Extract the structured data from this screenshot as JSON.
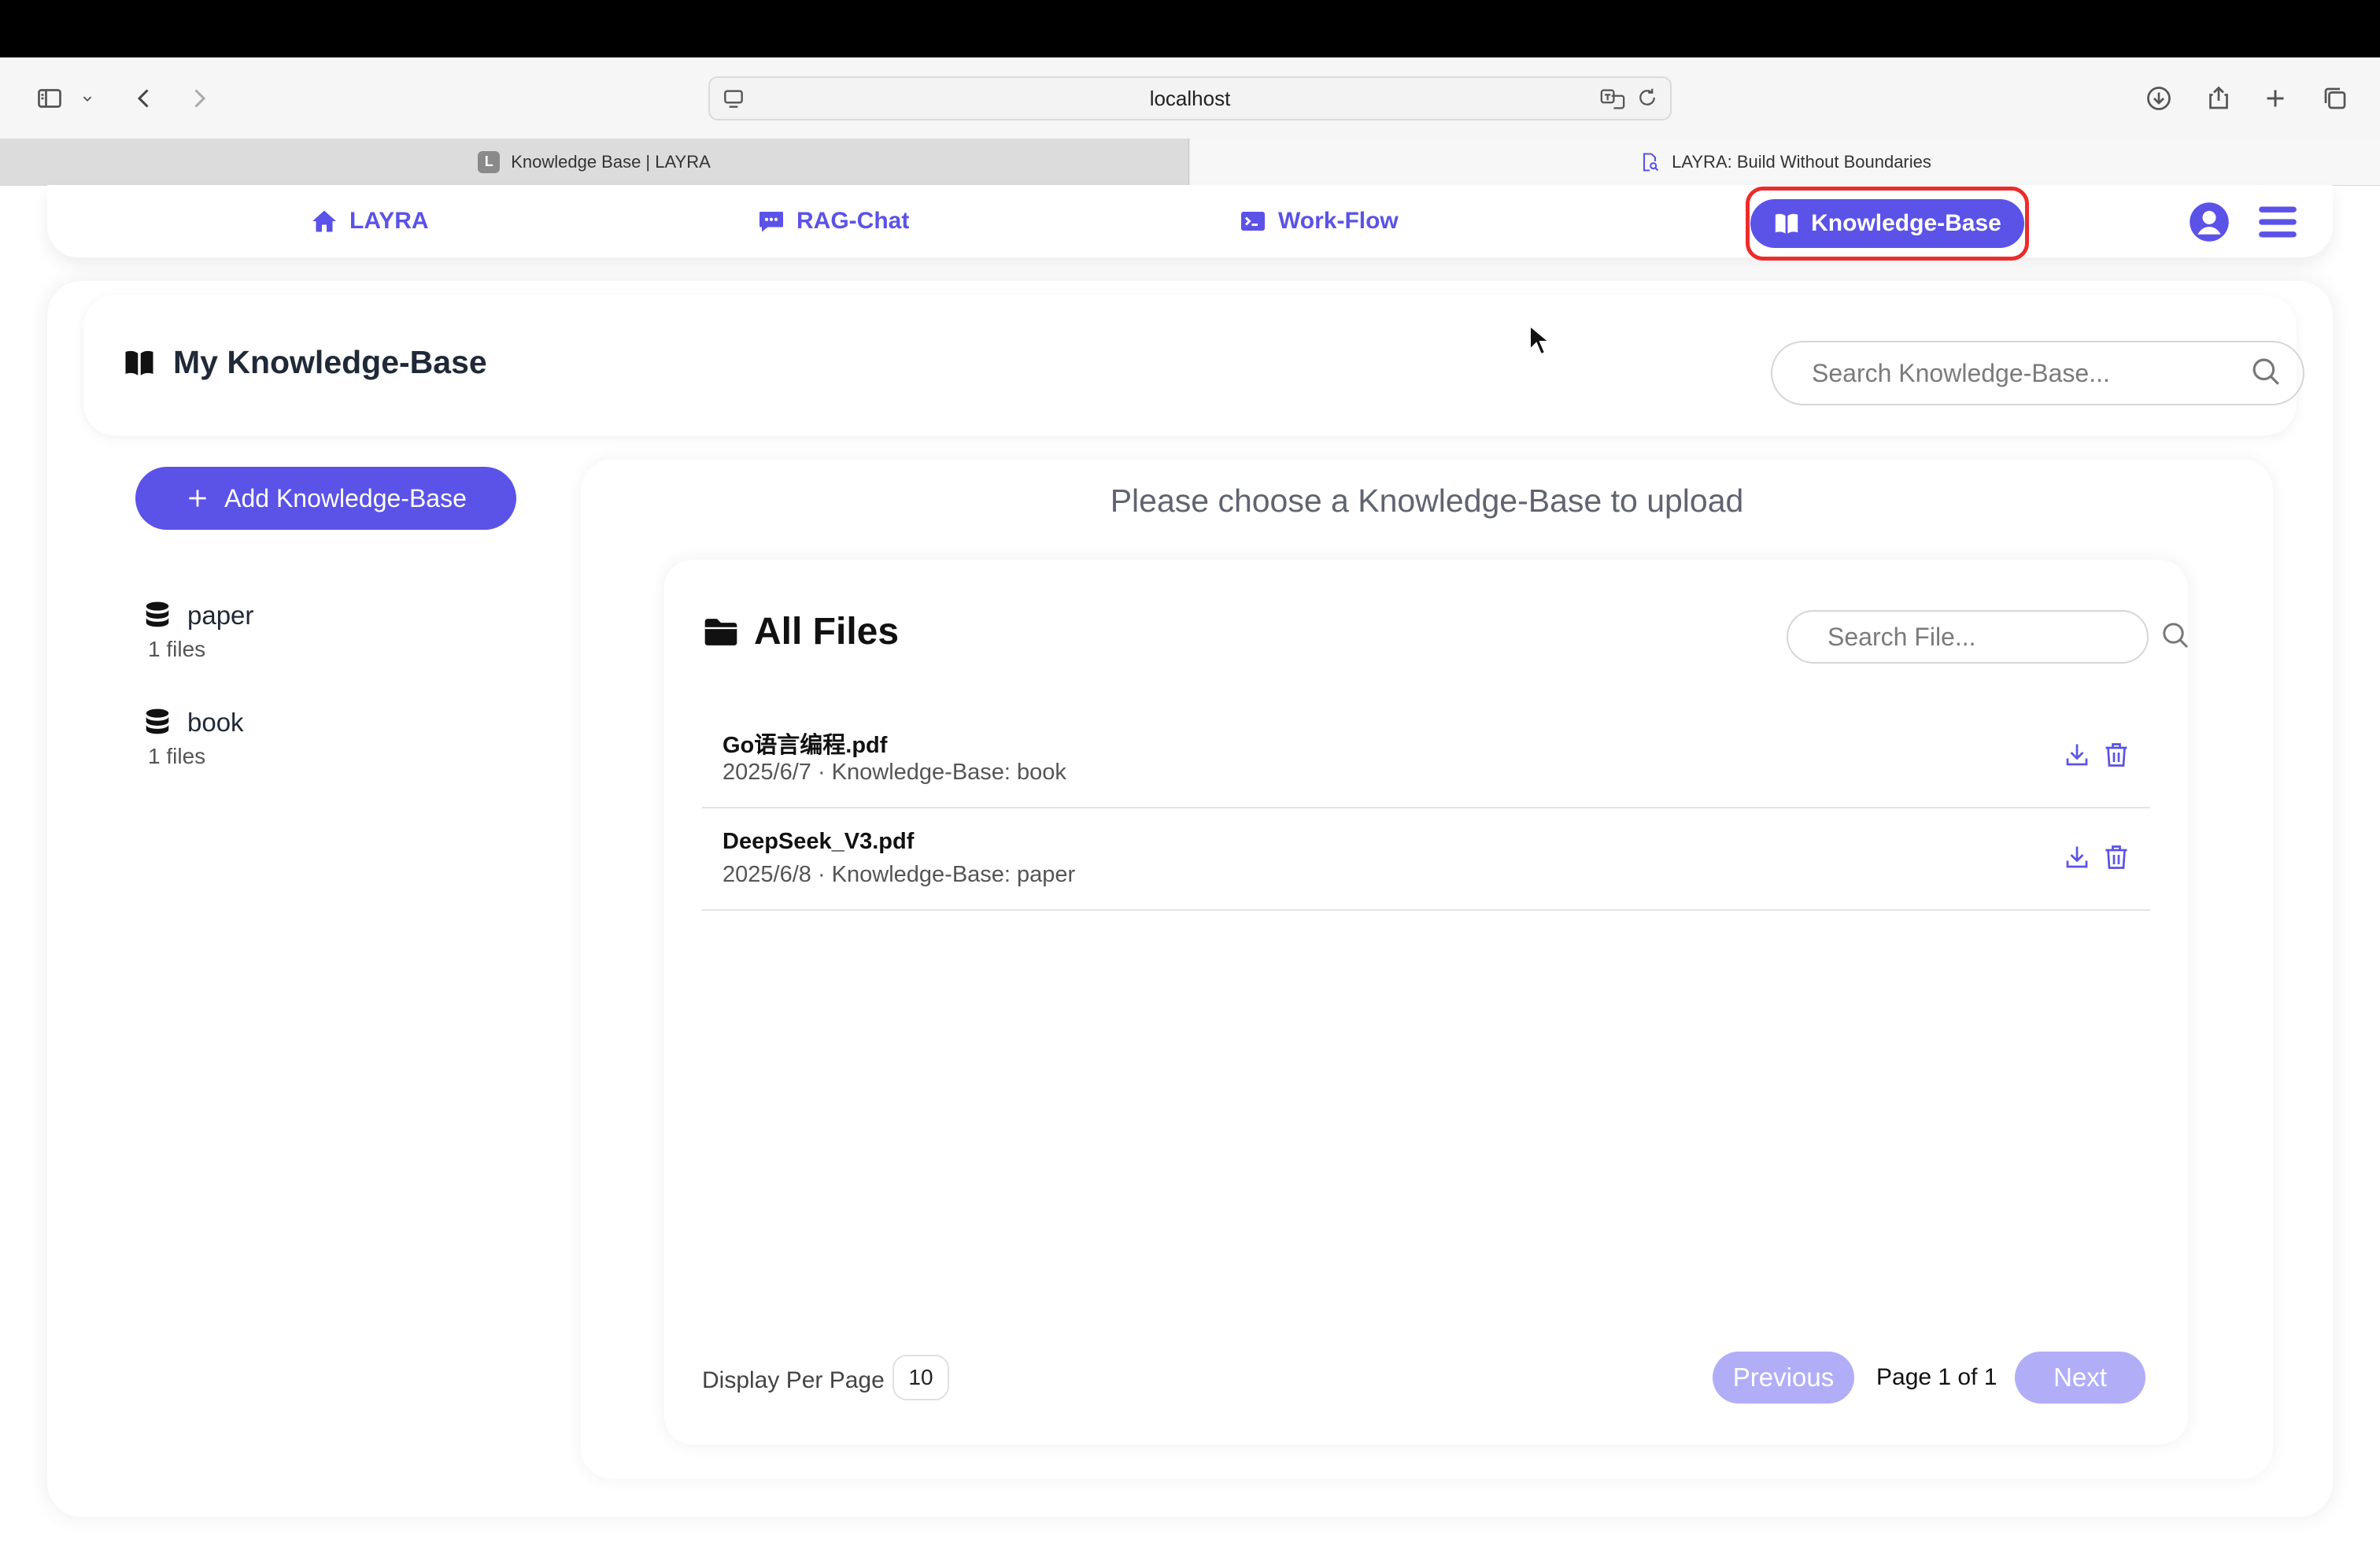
{
  "browser": {
    "url": "localhost",
    "tabs": [
      {
        "label": "Knowledge Base | LAYRA",
        "favicon": "L",
        "active": true
      },
      {
        "label": "LAYRA: Build Without Boundaries",
        "active": false
      }
    ]
  },
  "nav": {
    "items": [
      {
        "label": "LAYRA",
        "icon": "home-icon"
      },
      {
        "label": "RAG-Chat",
        "icon": "chat-icon"
      },
      {
        "label": "Work-Flow",
        "icon": "terminal-icon"
      },
      {
        "label": "Knowledge-Base",
        "icon": "book-icon",
        "active": true
      }
    ],
    "accent": "#5b52e8",
    "highlight_color": "#ee2b2b"
  },
  "header": {
    "title": "My Knowledge-Base",
    "search_placeholder": "Search Knowledge-Base..."
  },
  "sidebar": {
    "add_label": "Add Knowledge-Base",
    "knowledge_bases": [
      {
        "name": "paper",
        "count": "1 files"
      },
      {
        "name": "book",
        "count": "1 files"
      }
    ]
  },
  "main": {
    "prompt": "Please choose a Knowledge-Base to upload",
    "files_title": "All Files",
    "file_search_placeholder": "Search File...",
    "files": [
      {
        "name": "Go语言编程.pdf",
        "meta": "2025/6/7 · Knowledge-Base: book"
      },
      {
        "name": "DeepSeek_V3.pdf",
        "meta": "2025/6/8 · Knowledge-Base: paper"
      }
    ],
    "pagination": {
      "per_page_label": "Display Per Page",
      "per_page_value": "10",
      "previous": "Previous",
      "page_text": "Page 1 of 1",
      "next": "Next"
    }
  }
}
